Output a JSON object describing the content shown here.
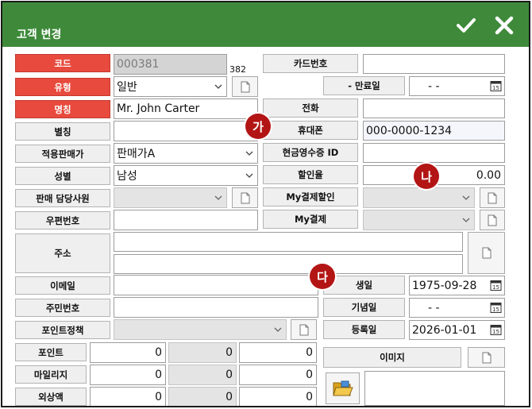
{
  "window": {
    "title": "고객 변경",
    "confirm_icon": "checkmark-icon",
    "close_icon": "close-x-icon"
  },
  "colors": {
    "titlebar": "#3e8a3a",
    "required_label": "#e84a3d",
    "marker": "#b31515"
  },
  "fields": {
    "code": {
      "label": "코드",
      "value": "000381",
      "count": "382"
    },
    "type": {
      "label": "유형",
      "value": "일반"
    },
    "name": {
      "label": "명칭",
      "value": "Mr. John Carter"
    },
    "alias": {
      "label": "별칭",
      "value": ""
    },
    "price_level": {
      "label": "적용판매가",
      "value": "판매가A"
    },
    "gender": {
      "label": "성별",
      "value": "남성"
    },
    "sales_rep": {
      "label": "판매 담당사원",
      "value": ""
    },
    "zipcode": {
      "label": "우편번호",
      "value": ""
    },
    "address": {
      "label": "주소",
      "line1": "",
      "line2": ""
    },
    "email": {
      "label": "이메일",
      "value": ""
    },
    "resident_no": {
      "label": "주민번호",
      "value": ""
    },
    "point_policy": {
      "label": "포인트정책",
      "value": ""
    },
    "points": {
      "label": "포인트",
      "values": [
        "0",
        "0",
        "0"
      ]
    },
    "mileage": {
      "label": "마일리지",
      "values": [
        "0",
        "0",
        "0"
      ]
    },
    "receivable": {
      "label": "외상액",
      "values": [
        "0",
        "0",
        "0"
      ]
    },
    "card_no": {
      "label": "카드번호",
      "value": ""
    },
    "expiry": {
      "label": "- 만료일",
      "value": "-    -"
    },
    "phone": {
      "label": "전화",
      "value": ""
    },
    "mobile": {
      "label": "휴대폰",
      "value": "000-0000-1234"
    },
    "cash_receipt_id": {
      "label": "현금영수증 ID",
      "value": ""
    },
    "discount_rate": {
      "label": "할인율",
      "value": "0.00"
    },
    "my_discount": {
      "label": "My결제할인",
      "value": ""
    },
    "my_payment": {
      "label": "My결제",
      "value": ""
    },
    "birthday": {
      "label": "생일",
      "value": "1975-09-28"
    },
    "anniversary": {
      "label": "기념일",
      "value": "-    -"
    },
    "registered": {
      "label": "등록일",
      "value": "2026-01-01"
    },
    "image": {
      "label": "이미지"
    }
  },
  "markers": {
    "a": "가",
    "b": "나",
    "c": "다"
  },
  "icons": {
    "doc": "document-icon",
    "calendar": "calendar-icon",
    "folder": "folder-open-icon",
    "dropdown": "chevron-down-icon"
  }
}
